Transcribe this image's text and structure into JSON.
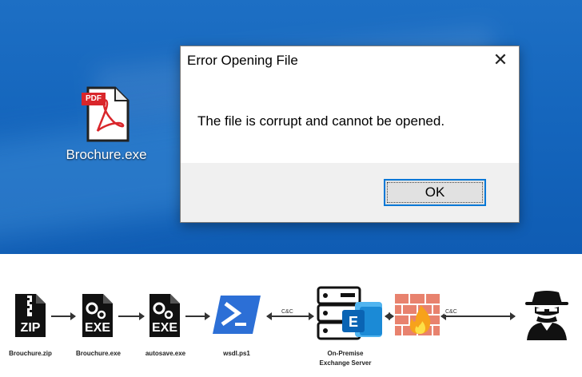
{
  "desktop": {
    "icon": {
      "name": "pdf-icon",
      "badge": "PDF",
      "label": "Brochure.exe"
    }
  },
  "dialog": {
    "title": "Error Opening File",
    "message": "The file is corrupt and cannot be opened.",
    "ok_label": "OK",
    "close_glyph": "✕"
  },
  "flow": {
    "nodes": [
      {
        "icon": "zip-file-icon",
        "badge": "ZIP",
        "label": "Brouchure.zip"
      },
      {
        "icon": "exe-file-icon",
        "badge": "EXE",
        "label": "Brouchure.exe"
      },
      {
        "icon": "exe-file-icon",
        "badge": "EXE",
        "label": "autosave.exe"
      },
      {
        "icon": "powershell-icon",
        "label": "wsdl.ps1"
      },
      {
        "icon": "exchange-server-icon",
        "label_line1": "On-Premise",
        "label_line2": "Exchange Server"
      },
      {
        "icon": "firewall-icon"
      },
      {
        "icon": "hacker-icon"
      }
    ],
    "cc_label_1": "C&C",
    "cc_label_2": "C&C"
  },
  "colors": {
    "desktop_blue": "#1566bd",
    "ok_focus_border": "#0078d7",
    "pdf_red": "#d9262b",
    "powershell_blue": "#2c6fd6",
    "exchange_blue": "#0a64b4"
  }
}
